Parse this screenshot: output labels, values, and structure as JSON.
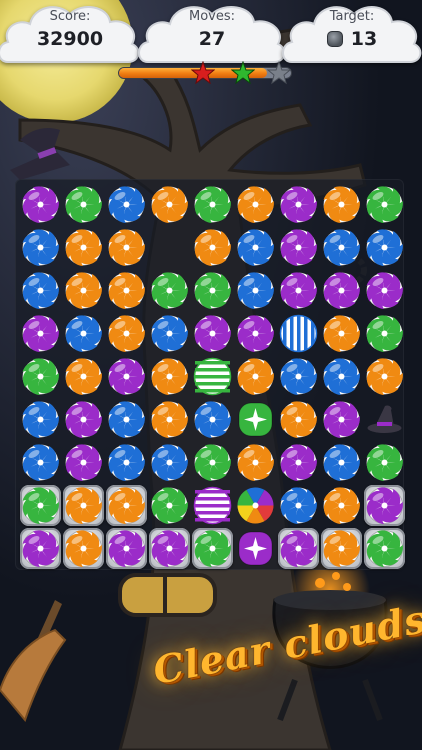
{
  "hud": {
    "score_label": "Score:",
    "score_value": "32900",
    "moves_label": "Moves:",
    "moves_value": "27",
    "target_label": "Target:",
    "target_value": "13",
    "target_icon": "cloud-tile-icon"
  },
  "progress": {
    "fill_fraction": 0.86,
    "stars_reached": 2,
    "stars_total": 3
  },
  "colors": {
    "purple": "#9b2cc9",
    "green": "#37b53f",
    "blue": "#1f6fd6",
    "orange": "#f08a12",
    "progress_orange": "#f07d12",
    "banner": "#ffb62e"
  },
  "board": {
    "rows": 9,
    "cols": 9,
    "legend": "P=purple swirl, G=green swirl, B=blue swirl, O=orange swirl, E=empty, sb=striped blue, sg=striped green, sp=striped purple, wg=wrapped green, wp=wrapped purple, rb=rainbow, hat=witch hat; trailing * = covered by cloud",
    "grid": [
      [
        "P",
        "G",
        "B",
        "O",
        "G",
        "O",
        "P",
        "O",
        "G"
      ],
      [
        "B",
        "O",
        "O",
        "E",
        "O",
        "B",
        "P",
        "B",
        "B"
      ],
      [
        "B",
        "O",
        "O",
        "G",
        "G",
        "B",
        "P",
        "P",
        "P"
      ],
      [
        "P",
        "B",
        "O",
        "B",
        "P",
        "P",
        "sb",
        "O",
        "G"
      ],
      [
        "G",
        "O",
        "P",
        "O",
        "sg",
        "O",
        "B",
        "B",
        "O"
      ],
      [
        "B",
        "P",
        "B",
        "O",
        "B",
        "wg",
        "O",
        "P",
        "hat"
      ],
      [
        "B",
        "P",
        "B",
        "B",
        "G",
        "O",
        "P",
        "B",
        "G"
      ],
      [
        "G*",
        "O*",
        "O*",
        "G",
        "sp",
        "rb",
        "B",
        "O",
        "P*"
      ],
      [
        "P*",
        "O*",
        "P*",
        "P*",
        "G*",
        "wp",
        "P*",
        "O*",
        "G*"
      ]
    ]
  },
  "banner": {
    "text": "Clear clouds"
  }
}
